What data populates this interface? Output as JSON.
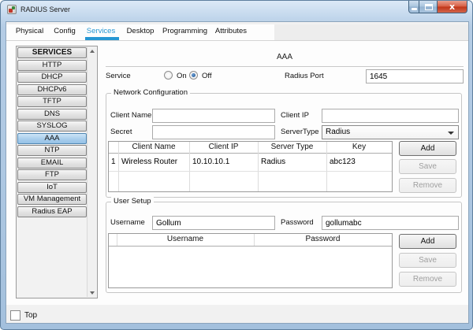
{
  "window": {
    "title": "RADIUS Server"
  },
  "tabs": [
    {
      "label": "Physical"
    },
    {
      "label": "Config"
    },
    {
      "label": "Services"
    },
    {
      "label": "Desktop"
    },
    {
      "label": "Programming"
    },
    {
      "label": "Attributes"
    }
  ],
  "active_tab": "Services",
  "sidebar": {
    "header": "SERVICES",
    "items": [
      {
        "label": "HTTP"
      },
      {
        "label": "DHCP"
      },
      {
        "label": "DHCPv6"
      },
      {
        "label": "TFTP"
      },
      {
        "label": "DNS"
      },
      {
        "label": "SYSLOG"
      },
      {
        "label": "AAA"
      },
      {
        "label": "NTP"
      },
      {
        "label": "EMAIL"
      },
      {
        "label": "FTP"
      },
      {
        "label": "IoT"
      },
      {
        "label": "VM Management"
      },
      {
        "label": "Radius EAP"
      }
    ],
    "selected": "AAA"
  },
  "aaa": {
    "title": "AAA",
    "service_label": "Service",
    "radio_on_label": "On",
    "radio_off_label": "Off",
    "service_state": "Off",
    "radius_port_label": "Radius Port",
    "radius_port_value": "1645",
    "network_config": {
      "title": "Network Configuration",
      "client_name_label": "Client Name",
      "client_name_value": "",
      "client_ip_label": "Client IP",
      "client_ip_value": "",
      "secret_label": "Secret",
      "secret_value": "",
      "server_type_label": "ServerType",
      "server_type_value": "Radius",
      "table": {
        "headers": [
          "Client Name",
          "Client IP",
          "Server Type",
          "Key"
        ],
        "rows": [
          {
            "num": "1",
            "client_name": "Wireless Router",
            "client_ip": "10.10.10.1",
            "server_type": "Radius",
            "key": "abc123"
          }
        ]
      },
      "buttons": {
        "add": "Add",
        "save": "Save",
        "remove": "Remove"
      }
    },
    "user_setup": {
      "title": "User Setup",
      "username_label": "Username",
      "username_value": "Gollum",
      "password_label": "Password",
      "password_value": "gollumabc",
      "table": {
        "headers": [
          "Username",
          "Password"
        ],
        "rows": []
      },
      "buttons": {
        "add": "Add",
        "save": "Save",
        "remove": "Remove"
      }
    }
  },
  "footer": {
    "top_checkbox_label": "Top",
    "checked": false
  },
  "colors": {
    "accent": "#2697d3",
    "titlebar": "#b4cce5",
    "selected_item": "#a8cdec",
    "close_button": "#bf3316"
  }
}
